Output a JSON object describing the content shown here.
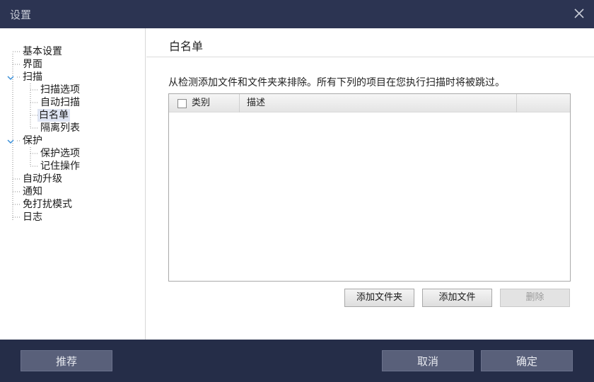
{
  "window": {
    "title": "设置"
  },
  "sidebar": {
    "items": [
      {
        "label": "基本设置"
      },
      {
        "label": "界面"
      },
      {
        "label": "扫描"
      },
      {
        "label": "扫描选项"
      },
      {
        "label": "自动扫描"
      },
      {
        "label": "白名单"
      },
      {
        "label": "隔离列表"
      },
      {
        "label": "保护"
      },
      {
        "label": "保护选项"
      },
      {
        "label": "记住操作"
      },
      {
        "label": "自动升级"
      },
      {
        "label": "通知"
      },
      {
        "label": "免打扰模式"
      },
      {
        "label": "日志"
      }
    ],
    "selected": "白名单"
  },
  "main": {
    "title": "白名单",
    "description": "从检测添加文件和文件夹来排除。所有下列的项目在您执行扫描时将被跳过。",
    "table": {
      "columns": [
        "类别",
        "描述"
      ],
      "rows": []
    },
    "buttons": {
      "add_folder": "添加文件夹",
      "add_file": "添加文件",
      "delete": "删除"
    }
  },
  "footer": {
    "recommend": "推荐",
    "cancel": "取消",
    "ok": "确定"
  },
  "colors": {
    "titlebar": "#2c3452",
    "footer": "#252d48",
    "footer_button": "#59607a",
    "selection": "#dfe5f3",
    "chevron": "#3a8fd8"
  }
}
